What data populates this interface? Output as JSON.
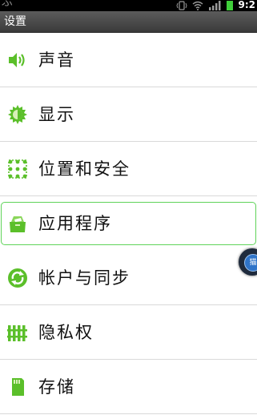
{
  "status_bar": {
    "time": "9:2",
    "left_glyph": "ぶ",
    "icons": [
      "vibrate-icon",
      "wifi-icon",
      "signal-icon",
      "battery-icon"
    ]
  },
  "title_bar": {
    "title": "设置"
  },
  "settings_items": [
    {
      "label": "声音",
      "icon": "speaker-icon"
    },
    {
      "label": "显示",
      "icon": "brightness-icon"
    },
    {
      "label": "位置和安全",
      "icon": "location-grid-icon"
    },
    {
      "label": "应用程序",
      "icon": "apps-box-icon",
      "selected": true
    },
    {
      "label": "帐户与同步",
      "icon": "sync-icon"
    },
    {
      "label": "隐私权",
      "icon": "privacy-fence-icon"
    },
    {
      "label": "存储",
      "icon": "sdcard-icon"
    }
  ],
  "floating_button": {
    "label": "猫"
  },
  "colors": {
    "accent_green": "#5fd35a",
    "icon_green": "#5bbf2a",
    "status_bar": "#000000",
    "title_bar": "#4a4a4a"
  }
}
